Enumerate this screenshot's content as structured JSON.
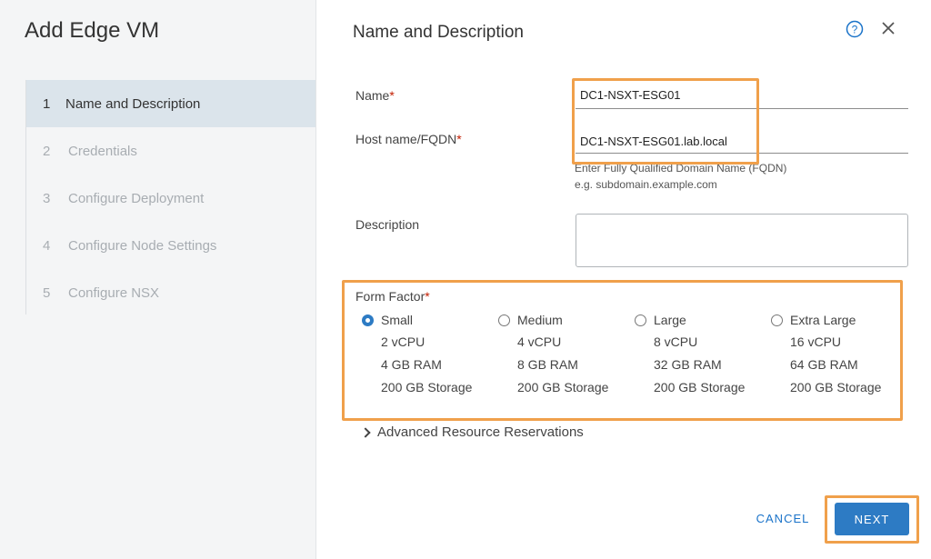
{
  "wizard": {
    "title": "Add Edge VM",
    "steps": [
      {
        "num": "1",
        "label": "Name and Description"
      },
      {
        "num": "2",
        "label": "Credentials"
      },
      {
        "num": "3",
        "label": "Configure Deployment"
      },
      {
        "num": "4",
        "label": "Configure Node Settings"
      },
      {
        "num": "5",
        "label": "Configure NSX"
      }
    ]
  },
  "main": {
    "title": "Name and Description",
    "name": {
      "label": "Name",
      "required": "*",
      "value": "DC1-NSXT-ESG01"
    },
    "hostname": {
      "label": "Host name/FQDN",
      "required": "*",
      "value": "DC1-NSXT-ESG01.lab.local",
      "hint_line1": "Enter Fully Qualified Domain Name (FQDN)",
      "hint_line2": "e.g. subdomain.example.com"
    },
    "description": {
      "label": "Description",
      "value": ""
    },
    "form_factor": {
      "label": "Form Factor",
      "required": "*",
      "selected": "Small",
      "options": [
        {
          "name": "Small",
          "cpu": "2 vCPU",
          "ram": "4 GB RAM",
          "storage": "200 GB Storage"
        },
        {
          "name": "Medium",
          "cpu": "4 vCPU",
          "ram": "8 GB RAM",
          "storage": "200 GB Storage"
        },
        {
          "name": "Large",
          "cpu": "8 vCPU",
          "ram": "32 GB RAM",
          "storage": "200 GB Storage"
        },
        {
          "name": "Extra Large",
          "cpu": "16 vCPU",
          "ram": "64 GB RAM",
          "storage": "200 GB Storage"
        }
      ]
    },
    "advanced": "Advanced Resource Reservations"
  },
  "footer": {
    "cancel_label": "CANCEL",
    "next_label": "NEXT"
  },
  "colors": {
    "accent": "#2d7bc4",
    "highlight": "#f0a04b",
    "required": "#c21d00"
  }
}
